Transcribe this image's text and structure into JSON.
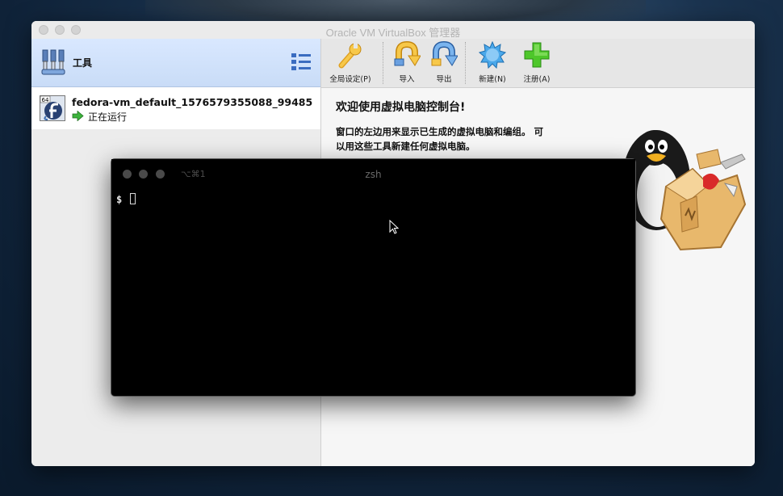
{
  "window": {
    "title": "Oracle VM VirtualBox 管理器"
  },
  "sidebar": {
    "tools_label": "工具",
    "vm": {
      "name": "fedora-vm_default_1576579355088_99485",
      "state": "正在运行",
      "os_badge": "64"
    }
  },
  "toolbar": {
    "buttons": [
      {
        "label": "全局设定(P)",
        "icon": "wrench-icon"
      },
      {
        "label": "导入",
        "icon": "import-arrow-icon"
      },
      {
        "label": "导出",
        "icon": "export-arrow-icon"
      },
      {
        "label": "新建(N)",
        "icon": "new-starburst-icon"
      },
      {
        "label": "注册(A)",
        "icon": "register-plus-icon"
      }
    ]
  },
  "welcome": {
    "title": "欢迎使用虚拟电脑控制台!",
    "line1": "窗口的左边用来显示已生成的虚拟电脑和编组。 可",
    "line2": "以用这些工具新建任何虚拟电脑。"
  },
  "terminal": {
    "shortcut": "⌥⌘1",
    "title": "zsh",
    "prompt": "$"
  },
  "colors": {
    "selection_blue": "#cfe0fa",
    "terminal_bg": "#000000",
    "running_green": "#3cb33c"
  }
}
